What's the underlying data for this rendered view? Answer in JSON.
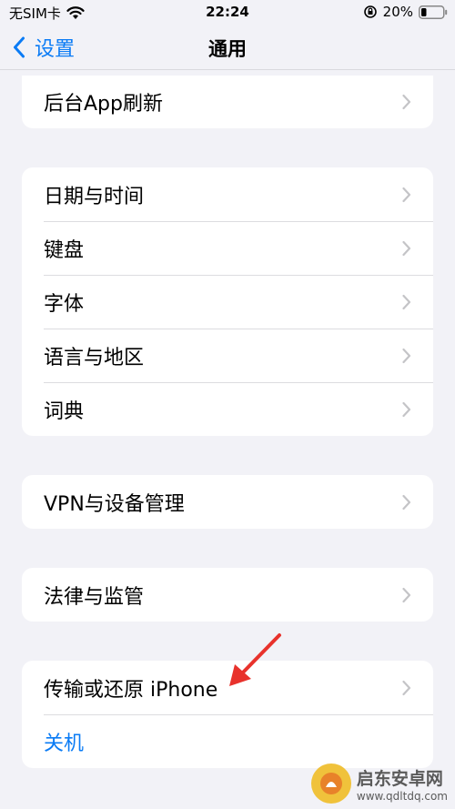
{
  "status_bar": {
    "carrier": "无SIM卡",
    "time": "22:24",
    "battery_percent": "20%"
  },
  "nav": {
    "back_label": "设置",
    "title": "通用"
  },
  "groups": [
    {
      "rows": [
        {
          "label": "后台App刷新"
        }
      ]
    },
    {
      "rows": [
        {
          "label": "日期与时间"
        },
        {
          "label": "键盘"
        },
        {
          "label": "字体"
        },
        {
          "label": "语言与地区"
        },
        {
          "label": "词典"
        }
      ]
    },
    {
      "rows": [
        {
          "label": "VPN与设备管理"
        }
      ]
    },
    {
      "rows": [
        {
          "label": "法律与监管"
        }
      ]
    },
    {
      "rows": [
        {
          "label": "传输或还原 iPhone"
        },
        {
          "label": "关机"
        }
      ]
    }
  ],
  "watermark": {
    "name": "启东安卓网",
    "url": "www.qdltdq.com"
  },
  "colors": {
    "accent": "#0a7bf5",
    "annotation_arrow": "#e8322c",
    "background": "#f2f2f7"
  }
}
